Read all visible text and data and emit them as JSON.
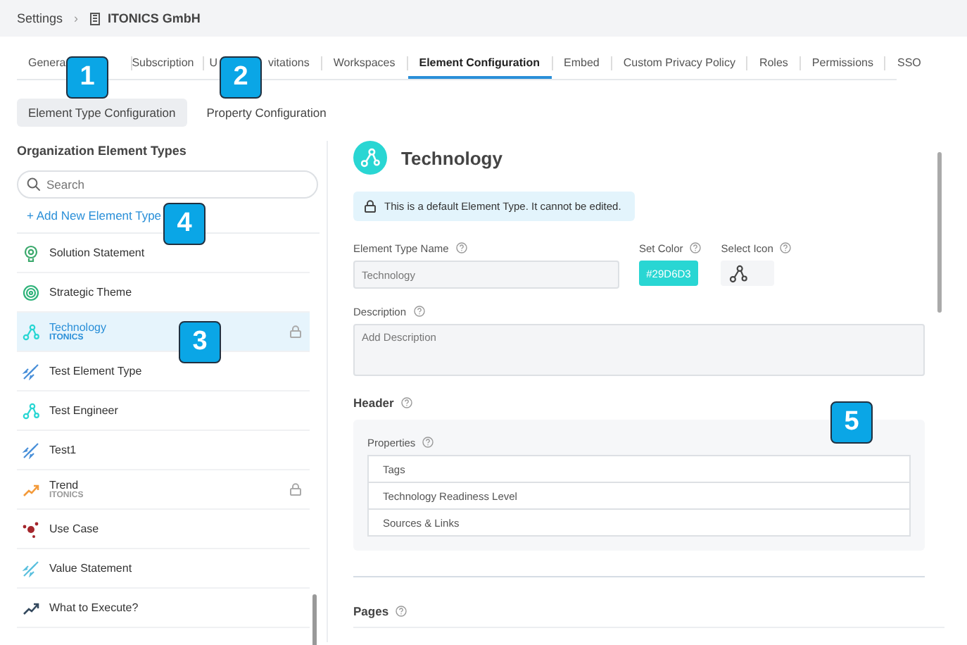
{
  "breadcrumb": {
    "root": "Settings",
    "separator": "›",
    "current": "ITONICS GmbH"
  },
  "tabs": [
    {
      "label": "Genera",
      "selected": false,
      "callout": "1"
    },
    {
      "label": "Subscription",
      "selected": false
    },
    {
      "label": "U",
      "tail": "vitations",
      "selected": false,
      "callout": "2"
    },
    {
      "label": "Workspaces",
      "selected": false
    },
    {
      "label": "Element Configuration",
      "selected": true
    },
    {
      "label": "Embed",
      "selected": false
    },
    {
      "label": "Custom Privacy Policy",
      "selected": false
    },
    {
      "label": "Roles",
      "selected": false
    },
    {
      "label": "Permissions",
      "selected": false
    },
    {
      "label": "SSO",
      "selected": false
    }
  ],
  "subtabs": [
    {
      "label": "Element Type Configuration",
      "selected": true
    },
    {
      "label": "Property Configuration",
      "selected": false
    }
  ],
  "sidebar": {
    "title": "Organization Element Types",
    "search": {
      "placeholder": "Search"
    },
    "add_link": {
      "label": "+ Add New Element Type",
      "callout": "4"
    },
    "items": [
      {
        "name": "Solution Statement",
        "kind": "bulb",
        "color": "#3aa86b",
        "selected": false,
        "locked": false
      },
      {
        "name": "Strategic Theme",
        "kind": "target",
        "color": "#2fb37a",
        "selected": false,
        "locked": false
      },
      {
        "name": "Technology",
        "sub": "ITONICS",
        "kind": "nodes",
        "color": "#29d6d3",
        "selected": true,
        "locked": true,
        "callout": "3"
      },
      {
        "name": "Test Element Type",
        "kind": "rocket",
        "color": "#4a90d9",
        "selected": false,
        "locked": false
      },
      {
        "name": "Test Engineer",
        "kind": "nodes",
        "color": "#29d6d3",
        "selected": false,
        "locked": false
      },
      {
        "name": "Test1",
        "kind": "rocket",
        "color": "#4a90d9",
        "selected": false,
        "locked": false
      },
      {
        "name": "Trend",
        "sub": "ITONICS",
        "kind": "trend",
        "color": "#f39a3a",
        "selected": false,
        "locked": true
      },
      {
        "name": "Use Case",
        "kind": "molecule",
        "color": "#a4262c",
        "selected": false,
        "locked": false
      },
      {
        "name": "Value Statement",
        "kind": "rocket",
        "color": "#5bc0de",
        "selected": false,
        "locked": false
      },
      {
        "name": "What to Execute?",
        "kind": "trend",
        "color": "#34495e",
        "selected": false,
        "locked": false
      }
    ]
  },
  "detail": {
    "title": "Technology",
    "notice": "This is a default Element Type. It cannot be edited.",
    "name_label": "Element Type Name",
    "name_value": "Technology",
    "color_label": "Set Color",
    "color_value": "#29D6D3",
    "color": "#29d6d3",
    "icon_label": "Select Icon",
    "description_label": "Description",
    "description_placeholder": "Add Description",
    "header": {
      "label": "Header",
      "properties_label": "Properties",
      "callout": "5",
      "properties": [
        "Tags",
        "Technology Readiness Level",
        "Sources & Links"
      ]
    },
    "pages_label": "Pages"
  }
}
